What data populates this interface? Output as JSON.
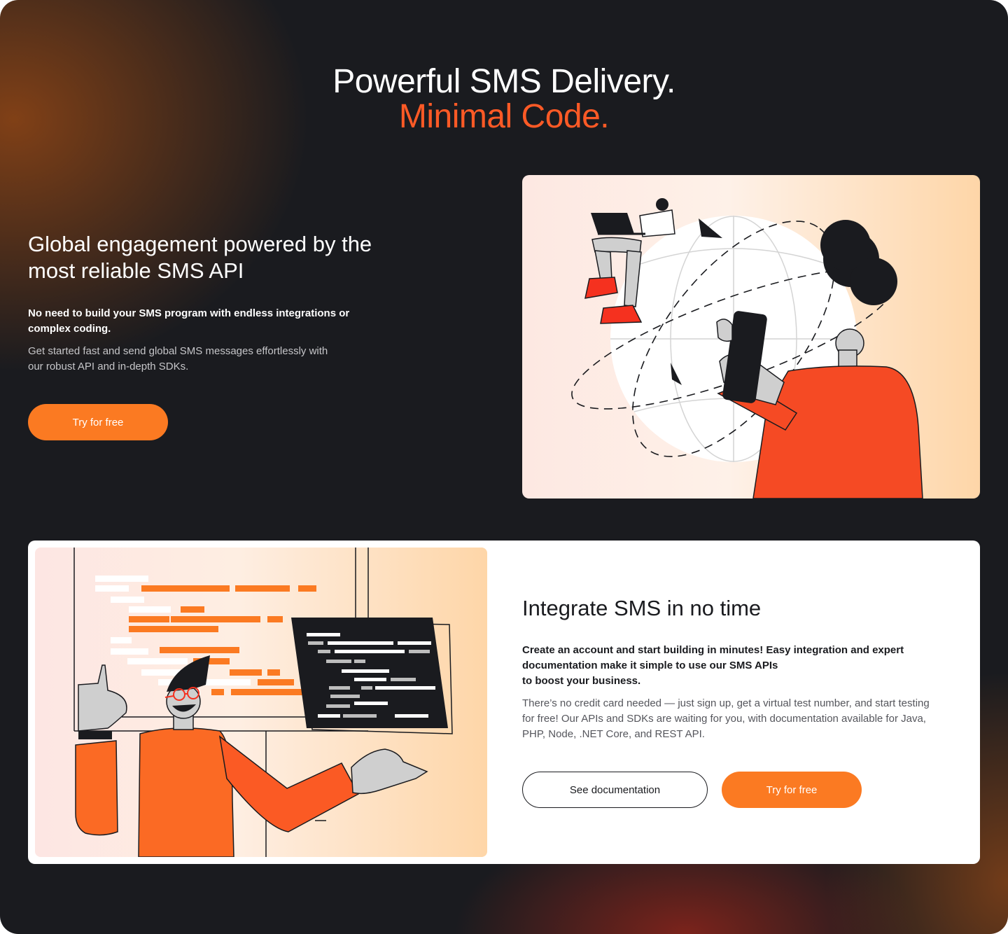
{
  "hero": {
    "line1": "Powerful SMS Delivery.",
    "line2": "Minimal Code."
  },
  "section1": {
    "heading": "Global engagement powered by the most reliable SMS API",
    "bold": "No need to build your SMS program with endless integrations or complex coding.",
    "body": "Get started fast and send global SMS messages effortlessly with our robust API and in-depth SDKs.",
    "cta_label": "Try for free"
  },
  "section2": {
    "heading": "Integrate SMS in no time",
    "bold_lines": [
      "Create an account and start building in minutes! Easy integration and expert",
      "documentation make it simple to use our SMS APIs",
      "to boost your business."
    ],
    "body": "There’s no credit card needed — just sign up, get a virtual test number, and start testing for free! Our APIs and SDKs are waiting for you, with documentation available for Java, PHP, Node, .NET Core, and REST API.",
    "docs_label": "See documentation",
    "cta_label": "Try for free"
  },
  "colors": {
    "background": "#1a1b1f",
    "accent": "#ff5a26",
    "button": "#fb7a22",
    "card": "#ffffff"
  }
}
